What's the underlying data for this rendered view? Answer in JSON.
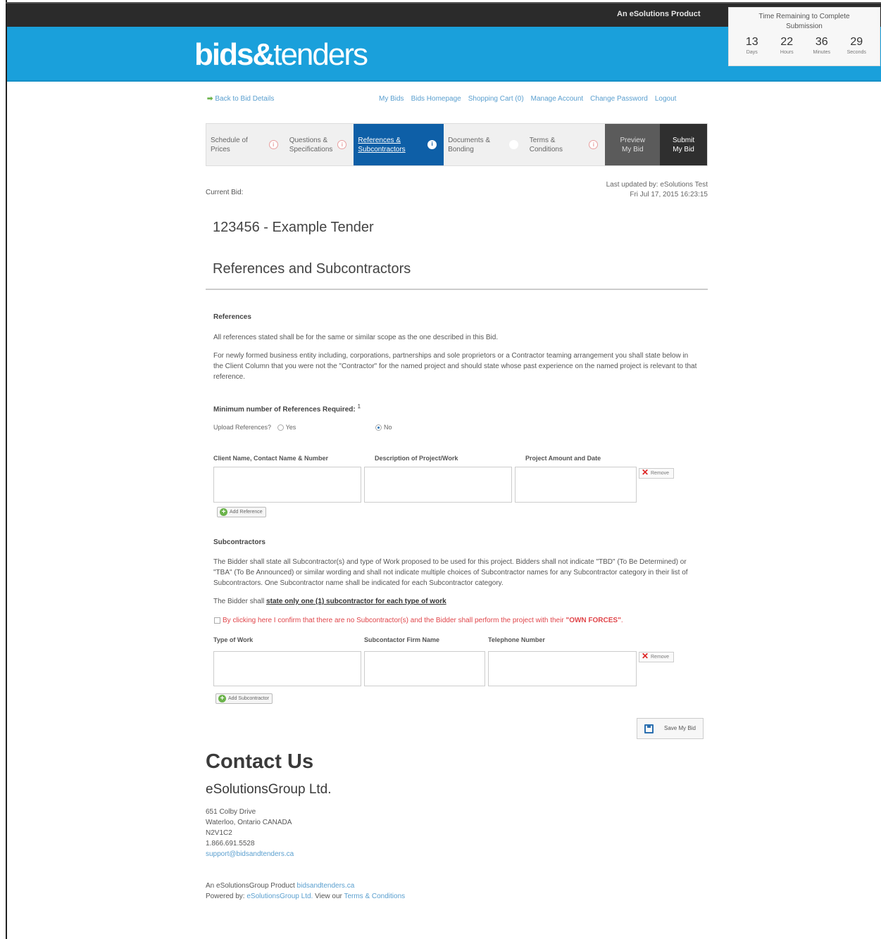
{
  "header": {
    "product_label": "An eSolutions Product",
    "logo_bold": "bids&",
    "logo_light": "tenders"
  },
  "timer": {
    "title": "Time Remaining to Complete Submission",
    "days": "13",
    "days_label": "Days",
    "hours": "22",
    "hours_label": "Hours",
    "minutes": "36",
    "minutes_label": "Minutes",
    "seconds": "29",
    "seconds_label": "Seconds"
  },
  "nav": {
    "back": "Back to Bid Details",
    "links": [
      "My Bids",
      "Bids Homepage",
      "Shopping Cart (0)",
      "Manage Account",
      "Change Password",
      "Logout"
    ]
  },
  "steps": [
    {
      "label": "Schedule of Prices",
      "info": "i"
    },
    {
      "label": "Questions & Specifications",
      "info": "i"
    },
    {
      "label": "References & Subcontractors",
      "info": "i"
    },
    {
      "label": "Documents & Bonding",
      "info": "i"
    },
    {
      "label": "Terms & Conditions",
      "info": "i"
    },
    {
      "label": "Preview My Bid"
    },
    {
      "label": "Submit My Bid"
    }
  ],
  "bid": {
    "current_label": "Current Bid:",
    "last_updated": "Last updated by: eSolutions Test",
    "last_updated_date": "Fri Jul 17, 2015 16:23:15",
    "title": "123456 - Example Tender",
    "section": "References and Subcontractors"
  },
  "references": {
    "heading": "References",
    "para1": "All references stated shall be for the same or similar scope as the one described in this Bid.",
    "para2": "For newly formed business entity including, corporations, partnerships and sole proprietors or a Contractor teaming arrangement you shall state below in the Client Column that you were not the \"Contractor\" for the named project and should state whose past experience on the named project is relevant to that reference.",
    "min_label": "Minimum number of References Required:",
    "min_value": "1",
    "upload_label": "Upload References?",
    "yes": "Yes",
    "no": "No",
    "columns": [
      "Client Name, Contact Name & Number",
      "Description of Project/Work",
      "Project Amount and Date"
    ],
    "remove": "Remove",
    "add": "Add Reference"
  },
  "subcontractors": {
    "heading": "Subcontractors",
    "para1": "The Bidder shall state all Subcontractor(s) and type of Work proposed to be used for this project. Bidders shall not indicate \"TBD\" (To Be Determined) or \"TBA\" (To Be Announced) or similar wording and shall not indicate multiple choices of Subcontractor names for any Subcontractor category in their list of Subcontractors. One Subcontractor name shall be indicated for each Subcontractor category.",
    "para2_prefix": "The Bidder shall ",
    "para2_emph": "state only one (1) subcontractor for each type of work",
    "confirm_text": "By clicking here I confirm that there are no Subcontractor(s) and the Bidder shall perform the project with their ",
    "confirm_emph": "\"OWN FORCES\"",
    "confirm_end": ".",
    "columns": [
      "Type of Work",
      "Subcontactor Firm Name",
      "Telephone Number"
    ],
    "remove": "Remove",
    "add": "Add Subcontractor"
  },
  "save_label": "Save My Bid",
  "contact": {
    "title": "Contact Us",
    "company": "eSolutionsGroup Ltd.",
    "address1": "651 Colby Drive",
    "address2": "Waterloo, Ontario CANADA",
    "address3": "N2V1C2",
    "phone": "1.866.691.5528",
    "email": "support@bidsandtenders.ca"
  },
  "footer": {
    "line1_prefix": "An eSolutionsGroup Product",
    "line1_link": "bidsandtenders.ca",
    "line2_prefix": "Powered by:",
    "line2_link": "eSolutionsGroup Ltd.",
    "line2_mid": "View our",
    "line2_link2": "Terms & Conditions"
  }
}
